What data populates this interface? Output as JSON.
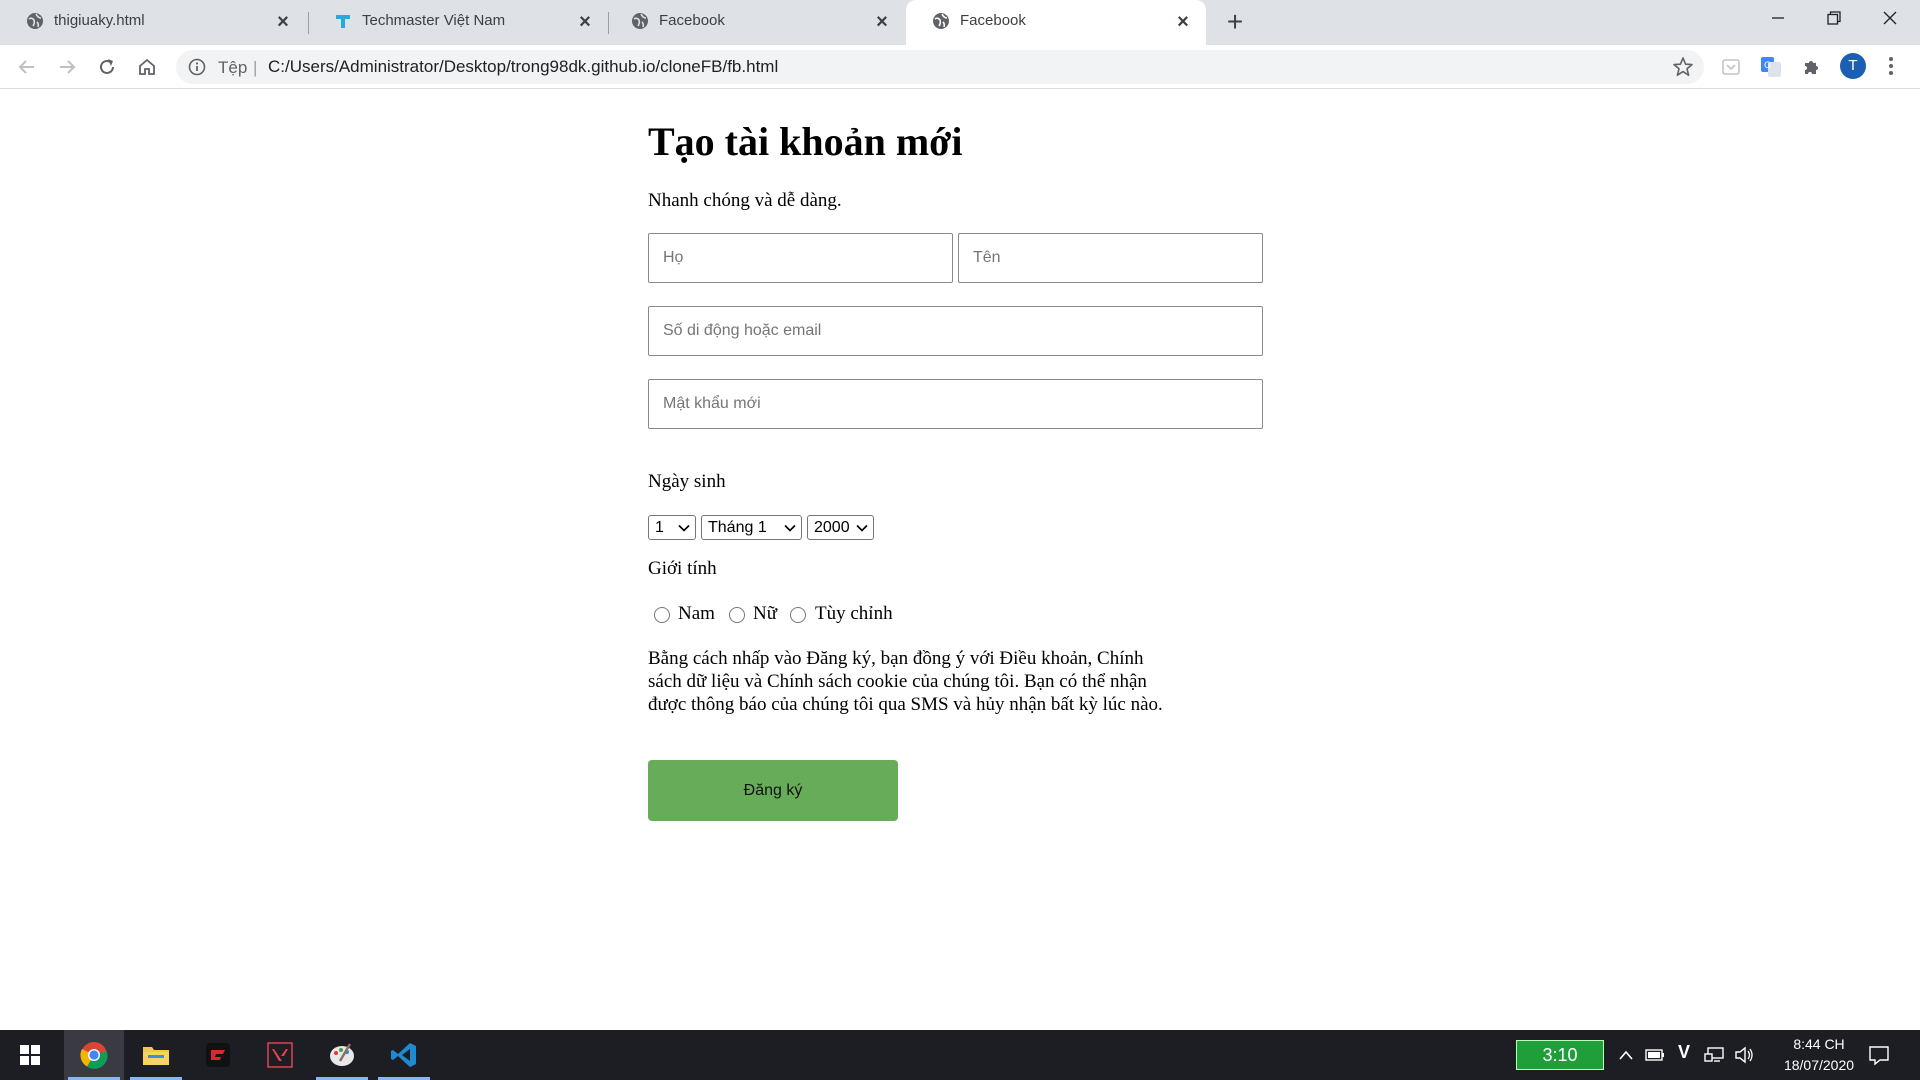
{
  "browser": {
    "tabs": [
      {
        "title": "thigiuaky.html",
        "icon": "globe-icon",
        "active": false
      },
      {
        "title": "Techmaster Việt Nam",
        "icon": "techmaster-logo-icon",
        "active": false
      },
      {
        "title": "Facebook",
        "icon": "globe-icon",
        "active": false
      },
      {
        "title": "Facebook",
        "icon": "globe-icon",
        "active": true
      }
    ],
    "address": {
      "scheme_label": "Tệp",
      "separator": "|",
      "url": "C:/Users/Administrator/Desktop/trong98dk.github.io/cloneFB/fb.html"
    },
    "profile_initial": "T"
  },
  "form": {
    "title": "Tạo tài khoản mới",
    "subtitle": "Nhanh chóng và dễ dàng.",
    "placeholders": {
      "last_name": "Họ",
      "first_name": "Tên",
      "contact": "Số di động hoặc email",
      "password": "Mật khẩu mới"
    },
    "birthday_label": "Ngày sinh",
    "birthday": {
      "day": "1",
      "month": "Tháng 1",
      "year": "2000"
    },
    "gender_label": "Giới tính",
    "genders": [
      "Nam",
      "Nữ",
      "Tùy chỉnh"
    ],
    "terms": "Bằng cách nhấp vào Đăng ký, bạn đồng ý với Điều khoản, Chính sách dữ liệu và Chính sách cookie của chúng tôi. Bạn có thể nhận được thông báo của chúng tôi qua SMS và hủy nhận bất kỳ lúc nào.",
    "submit_label": "Đăng ký",
    "submit_color": "#67ad59"
  },
  "taskbar": {
    "apps": [
      "windows-start-icon",
      "chrome-icon",
      "file-explorer-icon",
      "garena-icon",
      "valorant-icon",
      "paint-icon",
      "vscode-icon"
    ],
    "battery_timer": "3:10",
    "input_indicator": "V",
    "time": "8:44 CH",
    "date": "18/07/2020"
  }
}
